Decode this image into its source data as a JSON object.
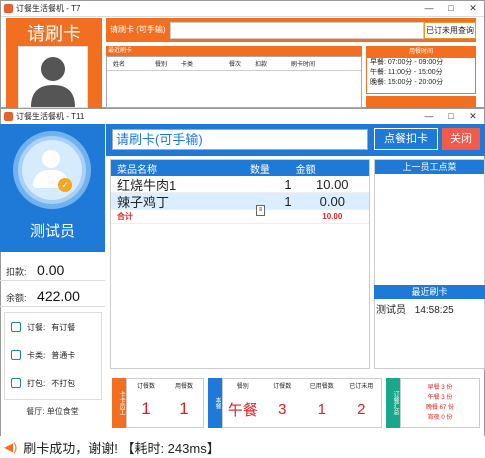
{
  "back_window": {
    "title": "订餐生活餐机 - T7",
    "header_title": "请刷卡",
    "card_label": "请刷卡 (可手输)",
    "query_button": "已订未用查询",
    "recent_label": "最近刷卡",
    "columns": [
      "姓名",
      "餐别",
      "卡类",
      "餐次",
      "扣款",
      "刷卡时间"
    ],
    "meal_time_title": "用餐时间",
    "meal_times": [
      "早餐: 07:00分 - 09:00分",
      "午餐: 11:00分 - 15:00分",
      "晚餐: 15:00分 - 20:00分"
    ]
  },
  "front_window": {
    "title": "订餐生活餐机 - T11",
    "user_name": "测试员",
    "deduct_label": "扣款:",
    "deduct_value": "0.00",
    "balance_label": "余额:",
    "balance_value": "422.00",
    "info": [
      {
        "label": "订餐:",
        "value": "有订餐"
      },
      {
        "label": "卡类:",
        "value": "普通卡"
      },
      {
        "label": "打包:",
        "value": "不打包"
      }
    ],
    "hall": "餐厅: 单位食堂",
    "card_input_placeholder": "请刷卡(可手输)",
    "deduct_button": "点餐扣卡",
    "close_button": "关闭",
    "grid_columns": {
      "name": "菜品名称",
      "qty": "数量",
      "amount": "金额"
    },
    "rows": [
      {
        "name": "红烧牛肉1",
        "qty": "1",
        "amount": "10.00"
      },
      {
        "name": "辣子鸡丁",
        "qty": "1",
        "amount": "0.00"
      }
    ],
    "total_label": "合计",
    "total_amount": "10.00",
    "prev_dishes_title": "上一员工点菜",
    "recent_title": "最近刷卡",
    "recent_name": "测试员",
    "recent_time": "14:58:25",
    "card_staff_tag": "卡卡员工",
    "card_staff_headers": [
      "订餐数",
      "用餐数"
    ],
    "card_staff_values": [
      "1",
      "1"
    ],
    "this_meal_tag": "本餐",
    "this_meal_headers": [
      "餐别",
      "订餐数",
      "已用餐数",
      "已订未用"
    ],
    "this_meal_values": [
      "午餐",
      "3",
      "1",
      "2"
    ],
    "summary_tag": "订餐汇总",
    "summary_lines": [
      "早餐 3 份",
      "午餐 3 份",
      "晚餐 67 份",
      "宵夜 0 份"
    ],
    "status_text": "刷卡成功，谢谢! 【耗时: 243ms】"
  },
  "colors": {
    "orange": "#f26f21",
    "blue": "#1e7ad6",
    "red": "#e02020",
    "teal": "#1aa88d"
  }
}
